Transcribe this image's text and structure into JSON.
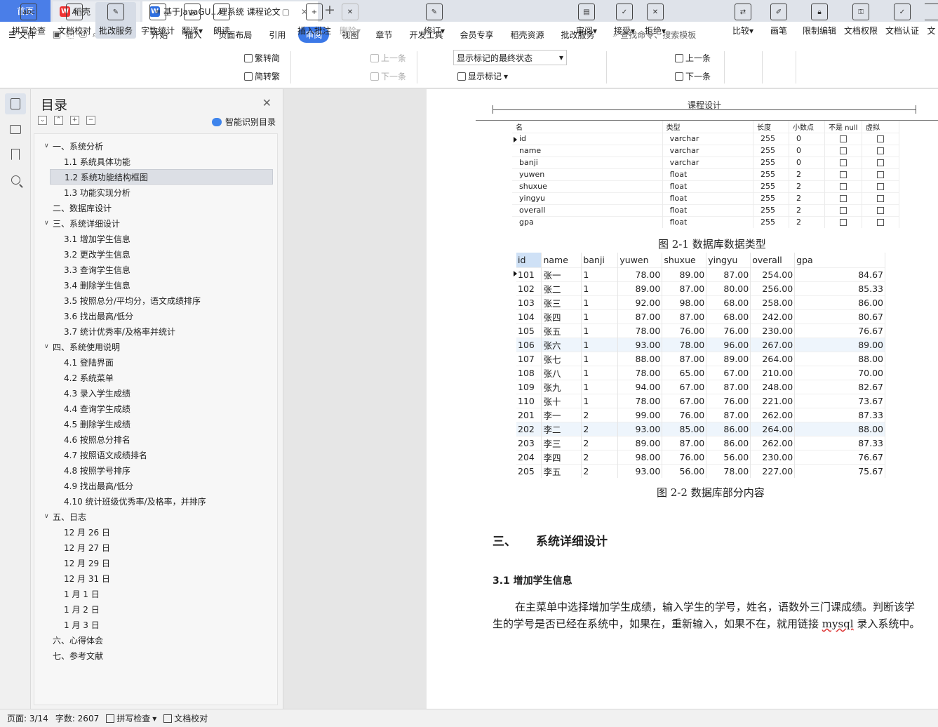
{
  "titlebar": {
    "home": "首页",
    "tabs": [
      {
        "label": "稻壳",
        "icon": "docer-icon"
      },
      {
        "label": "基于JavaGU...理系统 课程论文",
        "icon": "wps-writer-icon"
      }
    ]
  },
  "menu": {
    "file": "文件",
    "items": [
      "开始",
      "插入",
      "页面布局",
      "引用",
      "审阅",
      "视图",
      "章节",
      "开发工具",
      "会员专享",
      "稻壳资源",
      "批改服务"
    ],
    "active": "审阅",
    "search_placeholder": "查找命令、搜索模板"
  },
  "ribbon": {
    "spellcheck": "拼写检查",
    "doc_proof": "文档校对",
    "correction_service": "批改服务",
    "word_count": "字数统计",
    "translate": "翻译",
    "read_aloud": "朗读",
    "trad_to_simp": "繁转简",
    "simp_to_trad": "简转繁",
    "insert_comment": "插入批注",
    "delete": "删除",
    "prev_item": "上一条",
    "next_item": "下一条",
    "revise": "修订",
    "markup_state": "显示标记的最终状态",
    "show_markup": "显示标记",
    "review": "审阅",
    "accept": "接受",
    "reject": "拒绝",
    "prev_change": "上一条",
    "next_change": "下一条",
    "compare": "比较",
    "pen": "画笔",
    "restrict_edit": "限制编辑",
    "doc_permission": "文档权限",
    "doc_cert": "文档认证",
    "cutoff": "文"
  },
  "toc": {
    "title": "目录",
    "smart_label": "智能识别目录",
    "items": [
      {
        "label": "一、系统分析",
        "level": 1,
        "arrow": true
      },
      {
        "label": "1.1  系统具体功能",
        "level": 2
      },
      {
        "label": "1.2  系统功能结构框图",
        "level": 2,
        "selected": true
      },
      {
        "label": "1.3  功能实现分析",
        "level": 2
      },
      {
        "label": "二、数据库设计",
        "level": 1,
        "arrow": false
      },
      {
        "label": "三、系统详细设计",
        "level": 1,
        "arrow": true
      },
      {
        "label": "3.1  增加学生信息",
        "level": 2
      },
      {
        "label": "3.2  更改学生信息",
        "level": 2
      },
      {
        "label": "3.3  查询学生信息",
        "level": 2
      },
      {
        "label": "3.4  删除学生信息",
        "level": 2
      },
      {
        "label": "3.5  按照总分/平均分，语文成绩排序",
        "level": 2
      },
      {
        "label": "3.6  找出最高/低分",
        "level": 2
      },
      {
        "label": "3.7  统计优秀率/及格率并统计",
        "level": 2
      },
      {
        "label": "四、系统使用说明",
        "level": 1,
        "arrow": true
      },
      {
        "label": "4.1  登陆界面",
        "level": 2
      },
      {
        "label": "4.2  系统菜单",
        "level": 2
      },
      {
        "label": "4.3  录入学生成绩",
        "level": 2
      },
      {
        "label": "4.4 查询学生成绩",
        "level": 2
      },
      {
        "label": "4.5  删除学生成绩",
        "level": 2
      },
      {
        "label": "4.6  按照总分排名",
        "level": 2
      },
      {
        "label": "4.7  按照语文成绩排名",
        "level": 2
      },
      {
        "label": "4.8  按照学号排序",
        "level": 2
      },
      {
        "label": "4.9  找出最高/低分",
        "level": 2
      },
      {
        "label": "4.10  统计班级优秀率/及格率，并排序",
        "level": 2
      },
      {
        "label": "五、日志",
        "level": 1,
        "arrow": true
      },
      {
        "label": "12 月 26 日",
        "level": 2
      },
      {
        "label": "12 月 27  日",
        "level": 2
      },
      {
        "label": "12 月 29 日",
        "level": 2
      },
      {
        "label": "12 月 31 日",
        "level": 2
      },
      {
        "label": "1 月 1 日",
        "level": 2
      },
      {
        "label": "1 月 2 日",
        "level": 2
      },
      {
        "label": "1 月 3 日",
        "level": 2
      },
      {
        "label": "六、心得体会",
        "level": 1,
        "arrow": false
      },
      {
        "label": "七、参考文献",
        "level": 1,
        "arrow": false
      }
    ]
  },
  "page": {
    "header": "课程设计",
    "table1": {
      "columns": [
        "名",
        "类型",
        "长度",
        "小数点",
        "不是 null",
        "虚拟"
      ],
      "rows": [
        [
          "id",
          "varchar",
          "255",
          "0"
        ],
        [
          "name",
          "varchar",
          "255",
          "0"
        ],
        [
          "banji",
          "varchar",
          "255",
          "0"
        ],
        [
          "yuwen",
          "float",
          "255",
          "2"
        ],
        [
          "shuxue",
          "float",
          "255",
          "2"
        ],
        [
          "yingyu",
          "float",
          "255",
          "2"
        ],
        [
          "overall",
          "float",
          "255",
          "2"
        ],
        [
          "gpa",
          "float",
          "255",
          "2"
        ]
      ]
    },
    "caption1": "图 2-1 数据库数据类型",
    "table2": {
      "columns": [
        "id",
        "name",
        "banji",
        "yuwen",
        "shuxue",
        "yingyu",
        "overall",
        "gpa"
      ],
      "rows": [
        [
          "101",
          "张一",
          "1",
          "78.00",
          "89.00",
          "87.00",
          "254.00",
          "84.67"
        ],
        [
          "102",
          "张二",
          "1",
          "89.00",
          "87.00",
          "80.00",
          "256.00",
          "85.33"
        ],
        [
          "103",
          "张三",
          "1",
          "92.00",
          "98.00",
          "68.00",
          "258.00",
          "86.00"
        ],
        [
          "104",
          "张四",
          "1",
          "87.00",
          "87.00",
          "68.00",
          "242.00",
          "80.67"
        ],
        [
          "105",
          "张五",
          "1",
          "78.00",
          "76.00",
          "76.00",
          "230.00",
          "76.67"
        ],
        [
          "106",
          "张六",
          "1",
          "93.00",
          "78.00",
          "96.00",
          "267.00",
          "89.00"
        ],
        [
          "107",
          "张七",
          "1",
          "88.00",
          "87.00",
          "89.00",
          "264.00",
          "88.00"
        ],
        [
          "108",
          "张八",
          "1",
          "78.00",
          "65.00",
          "67.00",
          "210.00",
          "70.00"
        ],
        [
          "109",
          "张九",
          "1",
          "94.00",
          "67.00",
          "87.00",
          "248.00",
          "82.67"
        ],
        [
          "110",
          "张十",
          "1",
          "78.00",
          "67.00",
          "76.00",
          "221.00",
          "73.67"
        ],
        [
          "201",
          "李一",
          "2",
          "99.00",
          "76.00",
          "87.00",
          "262.00",
          "87.33"
        ],
        [
          "202",
          "李二",
          "2",
          "93.00",
          "85.00",
          "86.00",
          "264.00",
          "88.00"
        ],
        [
          "203",
          "李三",
          "2",
          "89.00",
          "87.00",
          "86.00",
          "262.00",
          "87.33"
        ],
        [
          "204",
          "李四",
          "2",
          "98.00",
          "76.00",
          "56.00",
          "230.00",
          "76.67"
        ],
        [
          "205",
          "李五",
          "2",
          "93.00",
          "56.00",
          "78.00",
          "227.00",
          "75.67"
        ]
      ]
    },
    "caption2": "图 2-2  数据库部分内容",
    "heading3_num": "三、",
    "heading3": "系统详细设计",
    "heading31": "3.1  增加学生信息",
    "para_before": "在主菜单中选择增加学生成绩，输入学生的学号，姓名，语数外三门课成绩。判断该学生的学号是否已经在系统中，如果在，重新输入，如果不在，就用链接 ",
    "para_link": "mysql",
    "para_after": " 录入系统中。"
  },
  "status": {
    "page": "页面: 3/14",
    "words": "字数: 2607",
    "spell": "拼写检查",
    "proof": "文档校对"
  }
}
